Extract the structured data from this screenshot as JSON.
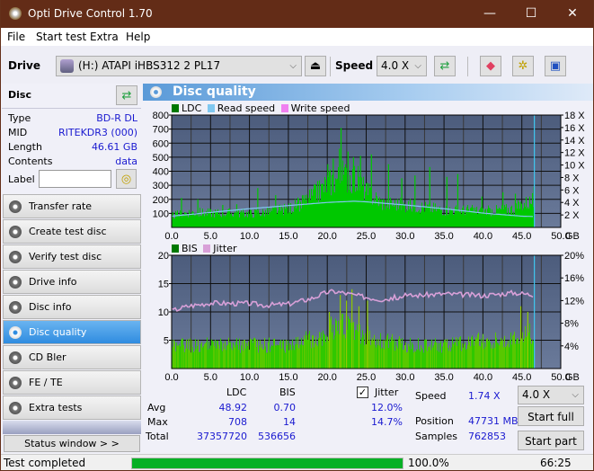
{
  "window": {
    "title": "Opti Drive Control 1.70",
    "controls": {
      "minimize": "—",
      "maximize": "☐",
      "close": "✕"
    }
  },
  "menu": [
    "File",
    "Start test",
    "Extra",
    "Help"
  ],
  "toolbar": {
    "drive_label": "Drive",
    "drive_value": "(H:)  ATAPI iHBS312  2 PL17",
    "speed_label": "Speed",
    "speed_value": "4.0 X"
  },
  "disc": {
    "header": "Disc",
    "rows": [
      {
        "key": "Type",
        "value": "BD-R DL"
      },
      {
        "key": "MID",
        "value": "RITEKDR3 (000)"
      },
      {
        "key": "Length",
        "value": "46.61 GB"
      },
      {
        "key": "Contents",
        "value": "data"
      }
    ],
    "label_key": "Label",
    "label_value": ""
  },
  "nav": [
    {
      "label": "Transfer rate",
      "active": false
    },
    {
      "label": "Create test disc",
      "active": false
    },
    {
      "label": "Verify test disc",
      "active": false
    },
    {
      "label": "Drive info",
      "active": false
    },
    {
      "label": "Disc info",
      "active": false
    },
    {
      "label": "Disc quality",
      "active": true
    },
    {
      "label": "CD Bler",
      "active": false
    },
    {
      "label": "FE / TE",
      "active": false
    },
    {
      "label": "Extra tests",
      "active": false
    }
  ],
  "status_window_button": "Status window > >",
  "panel_title": "Disc quality",
  "colors": {
    "ldc": "#00c800",
    "ldc_legend": "#007800",
    "read_speed": "#80c8f0",
    "write_speed": "#f080f0",
    "bis": "#40c000",
    "jitter": "#d8a0d8",
    "plot_bg_top": "#4c5c7c",
    "plot_bg_bottom": "#6a7a9a",
    "progress": "#06b025"
  },
  "chart_data": [
    {
      "type": "bar",
      "title": "LDC / Read speed",
      "legend": [
        "LDC",
        "Read speed",
        "Write speed"
      ],
      "xlabel": "GB",
      "x_ticks": [
        "0.0",
        "5.0",
        "10.0",
        "15.0",
        "20.0",
        "25.0",
        "30.0",
        "35.0",
        "40.0",
        "45.0",
        "50.0"
      ],
      "xlim": [
        0,
        50
      ],
      "ylim_left": [
        0,
        800
      ],
      "y_ticks_left": [
        "100",
        "200",
        "300",
        "400",
        "500",
        "600",
        "700",
        "800"
      ],
      "ylim_right": [
        0,
        18
      ],
      "y_ticks_right": [
        "2 X",
        "4 X",
        "6 X",
        "8 X",
        "10 X",
        "12 X",
        "14 X",
        "16 X",
        "18 X"
      ],
      "end_marker_gb": 46.61,
      "ldc_profile": {
        "x": [
          0,
          2,
          5,
          8,
          10,
          12,
          15,
          17,
          19,
          20,
          21,
          22,
          23,
          24,
          25,
          27,
          30,
          33,
          35,
          38,
          40,
          42,
          44,
          45,
          46.6
        ],
        "y": [
          100,
          130,
          125,
          125,
          120,
          130,
          160,
          220,
          310,
          380,
          410,
          440,
          430,
          400,
          300,
          210,
          190,
          170,
          150,
          150,
          140,
          150,
          160,
          200,
          230
        ]
      },
      "ldc_spikes": [
        [
          1.2,
          210
        ],
        [
          3.3,
          200
        ],
        [
          6.5,
          160
        ],
        [
          8.3,
          165
        ],
        [
          11,
          280
        ],
        [
          13.3,
          230
        ],
        [
          16.8,
          230
        ],
        [
          18.7,
          330
        ],
        [
          20,
          450
        ],
        [
          20.7,
          490
        ],
        [
          21.5,
          560
        ],
        [
          21.7,
          708
        ],
        [
          22.6,
          540
        ],
        [
          23.3,
          500
        ],
        [
          24.2,
          510
        ],
        [
          25.6,
          520
        ],
        [
          27.8,
          450
        ],
        [
          29.5,
          350
        ],
        [
          31.2,
          370
        ],
        [
          33.1,
          430
        ],
        [
          35.3,
          360
        ],
        [
          36.7,
          380
        ],
        [
          39.8,
          220
        ],
        [
          42.5,
          250
        ],
        [
          44.1,
          240
        ],
        [
          46.5,
          290
        ]
      ],
      "read_speed": {
        "x": [
          0,
          5,
          10,
          15,
          20,
          23.5,
          25,
          30,
          35,
          40,
          45,
          46.6
        ],
        "y": [
          1.8,
          2.4,
          3.0,
          3.5,
          4.0,
          4.2,
          4.1,
          3.6,
          3.0,
          2.3,
          1.8,
          1.74
        ]
      }
    },
    {
      "type": "bar",
      "title": "BIS / Jitter",
      "legend": [
        "BIS",
        "Jitter"
      ],
      "xlabel": "GB",
      "x_ticks": [
        "0.0",
        "5.0",
        "10.0",
        "15.0",
        "20.0",
        "25.0",
        "30.0",
        "35.0",
        "40.0",
        "45.0",
        "50.0"
      ],
      "xlim": [
        0,
        50
      ],
      "ylim_left": [
        0,
        20
      ],
      "y_ticks_left": [
        "5",
        "10",
        "15",
        "20"
      ],
      "ylim_right": [
        0,
        20
      ],
      "y_ticks_right": [
        "4%",
        "8%",
        "12%",
        "16%",
        "20%"
      ],
      "end_marker_gb": 46.61,
      "bis_profile": {
        "x": [
          0,
          5,
          10,
          15,
          17,
          19,
          20,
          21,
          22,
          23,
          24,
          25,
          27,
          30,
          35,
          40,
          44,
          45,
          46.6
        ],
        "y": [
          5,
          5,
          5,
          5,
          6,
          7,
          8,
          9,
          9,
          9,
          8,
          7,
          6,
          5,
          5,
          6,
          6,
          7,
          8
        ]
      },
      "bis_spikes": [
        [
          20.2,
          10
        ],
        [
          21.6,
          13
        ],
        [
          22.4,
          12
        ],
        [
          23.1,
          14
        ],
        [
          24.0,
          11
        ],
        [
          25.1,
          12
        ],
        [
          44.8,
          11
        ],
        [
          45.7,
          10
        ]
      ],
      "jitter": {
        "x": [
          0,
          2,
          5,
          8,
          10,
          12,
          15,
          18,
          20,
          21,
          22,
          23,
          25,
          27,
          30,
          35,
          40,
          44,
          46.6
        ],
        "y": [
          10.2,
          11.0,
          11.6,
          11.5,
          11.5,
          11.2,
          11.4,
          12.4,
          13.5,
          13.6,
          13.4,
          13.1,
          12.6,
          12.2,
          12.8,
          13.2,
          12.9,
          13.4,
          13.0
        ]
      }
    }
  ],
  "stats": {
    "col_ldc": "LDC",
    "col_bis": "BIS",
    "jitter_label": "Jitter",
    "jitter_checked": true,
    "rows": [
      {
        "label": "Avg",
        "ldc": "48.92",
        "bis": "0.70",
        "jitter": "12.0%"
      },
      {
        "label": "Max",
        "ldc": "708",
        "bis": "14",
        "jitter": "14.7%"
      },
      {
        "label": "Total",
        "ldc": "37357720",
        "bis": "536656",
        "jitter": ""
      }
    ],
    "speed_label": "Speed",
    "speed_value": "1.74 X",
    "position_label": "Position",
    "position_value": "47731 MB",
    "samples_label": "Samples",
    "samples_value": "762853",
    "speed_select": "4.0 X",
    "start_full": "Start full",
    "start_part": "Start part"
  },
  "status": {
    "text": "Test completed",
    "progress": 100.0,
    "progress_text": "100.0%",
    "time": "66:25"
  }
}
